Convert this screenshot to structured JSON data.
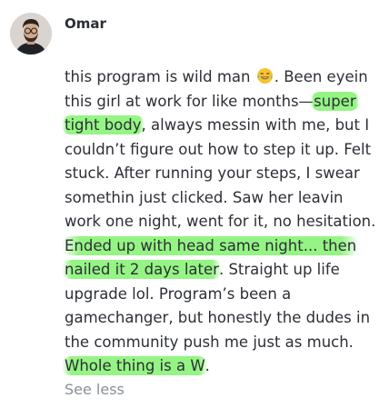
{
  "post": {
    "author": "Omar",
    "text_1": "this program is wild man ",
    "emoji": "laughing-tears-emoji",
    "text_2": ". Been eyein this girl at work for like months—",
    "hl_1": "super tight body",
    "text_3": ", always messin with me, but I couldn’t figure out how to step it up. Felt stuck. After running your steps, I swear somethin just clicked. Saw her leavin work one night, went for it, no hesitation. ",
    "hl_2": "Ended up with head same night... then nailed it 2 days later",
    "text_4": ". Straight up life upgrade lol. Program’s been a gamechanger, but honestly the dudes in the community push me just as much. ",
    "hl_3": "Whole thing is a W",
    "text_5": ".",
    "see_less": "See less"
  },
  "colors": {
    "highlight": "#82f36e",
    "text": "#2c2f36",
    "muted": "#8a8f98"
  }
}
